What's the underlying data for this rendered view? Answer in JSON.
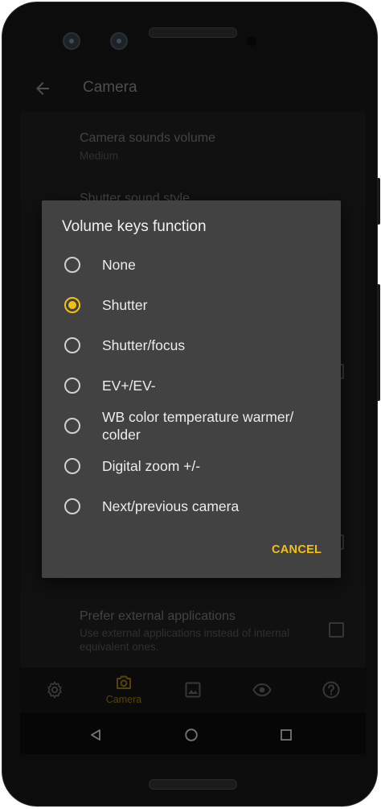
{
  "appbar": {
    "title": "Camera",
    "back_icon": "arrow-back-icon"
  },
  "settings": [
    {
      "title": "Camera sounds volume",
      "subtitle": "Medium"
    },
    {
      "title": "Shutter sound style"
    },
    {
      "title": "Prefer external applications",
      "subtitle": "Use external applications instead of internal equivalent ones."
    }
  ],
  "dialog": {
    "title": "Volume keys function",
    "selected_index": 1,
    "options": [
      "None",
      "Shutter",
      "Shutter/focus",
      "EV+/EV-",
      "WB color temperature warmer/ colder",
      "Digital zoom +/-",
      "Next/previous camera"
    ],
    "cancel_label": "CANCEL"
  },
  "bottom_nav": {
    "items": [
      {
        "icon": "gear-icon",
        "label": ""
      },
      {
        "icon": "camera-icon",
        "label": "Camera",
        "active": true
      },
      {
        "icon": "image-icon",
        "label": ""
      },
      {
        "icon": "eye-icon",
        "label": ""
      },
      {
        "icon": "help-icon",
        "label": ""
      }
    ]
  },
  "system_nav": {
    "icons": [
      "back-triangle-icon",
      "home-circle-icon",
      "recents-square-icon"
    ]
  },
  "colors": {
    "accent": "#f2c10f",
    "dialog_bg": "#424242",
    "screen_bg": "#1c1c1c"
  }
}
